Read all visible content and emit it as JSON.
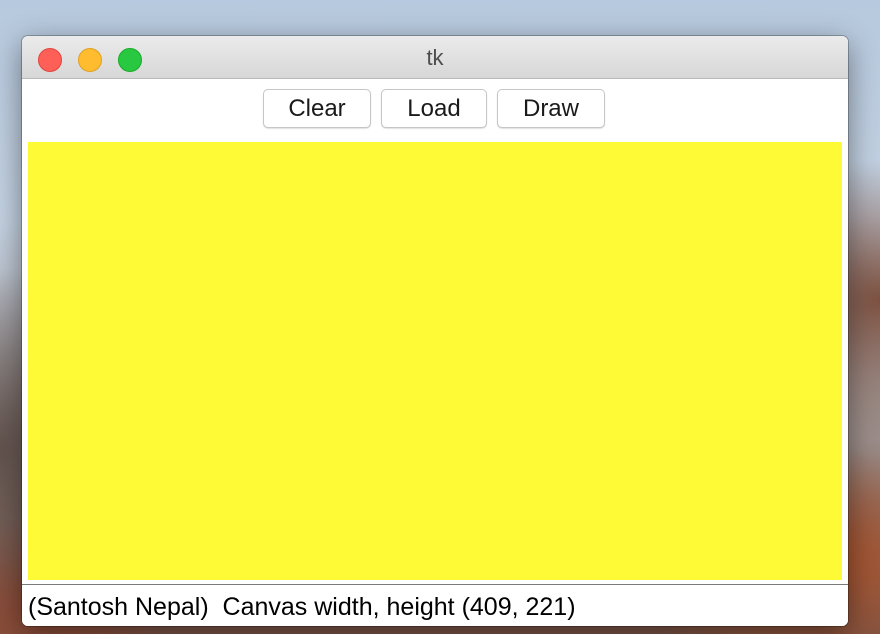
{
  "window": {
    "title": "tk"
  },
  "toolbar": {
    "clear_label": "Clear",
    "load_label": "Load",
    "draw_label": "Draw"
  },
  "canvas": {
    "background_color": "#fefb36"
  },
  "status": {
    "text": "(Santosh Nepal)  Canvas width, height (409, 221)"
  },
  "colors": {
    "close": "#fe5f57",
    "minimize": "#febc2e",
    "zoom": "#28c840"
  }
}
